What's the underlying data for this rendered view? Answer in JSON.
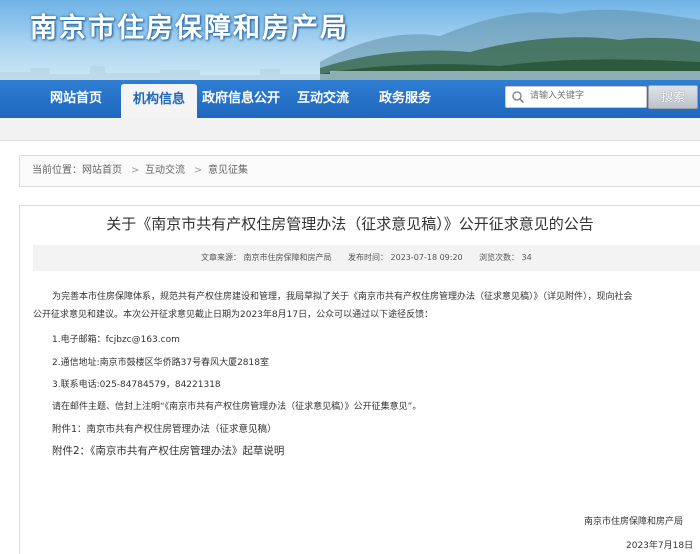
{
  "header": {
    "site_title": "南京市住房保障和房产局"
  },
  "nav": {
    "items": [
      {
        "label": "网站首页",
        "active": false
      },
      {
        "label": "机构信息",
        "active": true
      },
      {
        "label": "政府信息公开",
        "active": false
      },
      {
        "label": "互动交流",
        "active": false
      },
      {
        "label": "政务服务",
        "active": false
      }
    ],
    "search_placeholder": "请输入关键字",
    "search_button": "搜索"
  },
  "breadcrumb": {
    "current": "当前位置：",
    "home": "网站首页",
    "sep": ">",
    "level1": "互动交流",
    "level2": "意见征集"
  },
  "article": {
    "title": "关于《南京市共有产权住房管理办法（征求意见稿）》公开征求意见的公告",
    "source": "文章来源：  南京市住房保障和房产局",
    "published": "发布时间：  2023-07-18 09:20",
    "views": "浏览次数：  34",
    "paragraphs": [
      "为完善本市住房保障体系，规范共有产权住房建设和管理，我局草拟了关于《南京市共有产权住房管理办法（征求意见稿）》（详见附件），现向社会",
      "公开征求意见和建议。本次公开征求意见截止日期为2023年8月17日，公众可以通过以下途径反馈：",
      "1.电子邮箱：fcjbzc@163.com",
      "2.通信地址:南京市鼓楼区华侨路37号春风大厦2818室",
      "3.联系电话:025-84784579，84221318",
      "请在邮件主题、信封上注明“《南京市共有产权住房管理办法（征求意见稿）》公开征集意见”。",
      "附件1：南京市共有产权住房管理办法（征求意见稿）",
      "附件2：《南京市共有产权住房管理办法》起草说明"
    ],
    "signature_org": "南京市住房保障和房产局",
    "signature_date": "2023年7月18日"
  }
}
